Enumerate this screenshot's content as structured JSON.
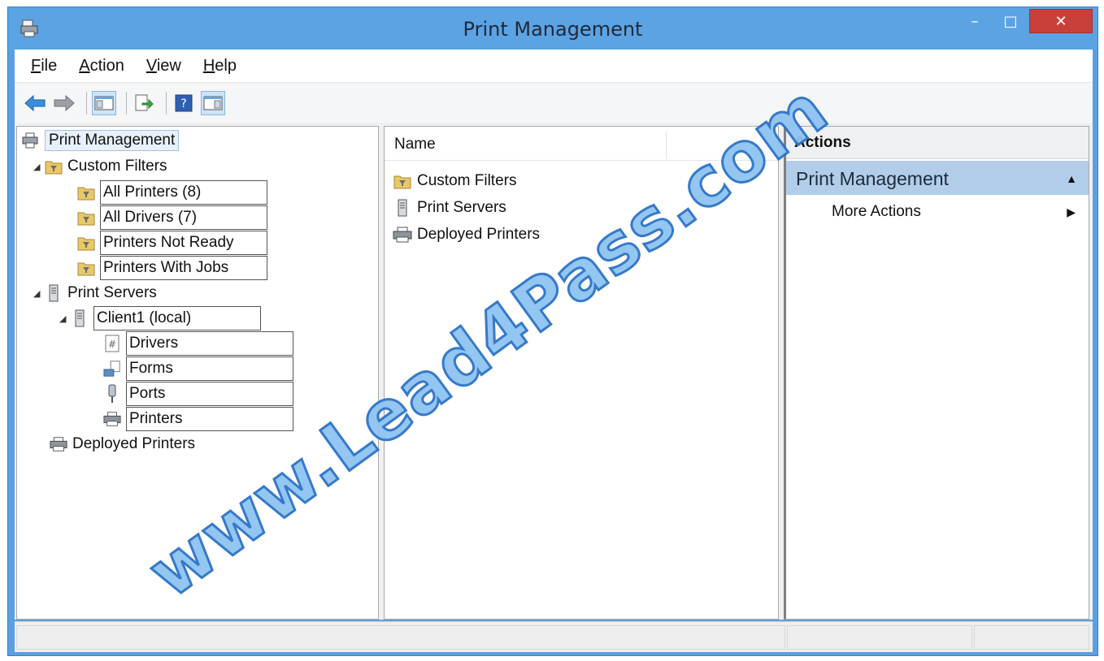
{
  "window": {
    "title": "Print Management",
    "accent": "#5ca3e4",
    "close_color": "#c9403b",
    "controls": {
      "minimize": "–",
      "maximize": "□",
      "close": "✕"
    }
  },
  "menubar": [
    {
      "first": "F",
      "rest": "ile"
    },
    {
      "first": "A",
      "rest": "ction"
    },
    {
      "first": "V",
      "rest": "iew"
    },
    {
      "first": "H",
      "rest": "elp"
    }
  ],
  "toolbar": {
    "icons": [
      "back-arrow-icon",
      "forward-arrow-icon",
      "show-hide-console-tree-icon",
      "export-list-icon",
      "help-icon",
      "show-hide-action-pane-icon"
    ]
  },
  "tree": {
    "root": "Print Management",
    "custom_filters": "Custom Filters",
    "all_printers": "All Printers (8)",
    "all_drivers": "All Drivers (7)",
    "printers_not_ready": "Printers Not Ready",
    "printers_with_jobs": "Printers With Jobs",
    "print_servers": "Print Servers",
    "client1": "Client1 (local)",
    "drivers": "Drivers",
    "forms": "Forms",
    "ports": "Ports",
    "printers": "Printers",
    "deployed_printers": "Deployed Printers"
  },
  "list": {
    "header_name": "Name",
    "rows": [
      "Custom Filters",
      "Print Servers",
      "Deployed Printers"
    ]
  },
  "actions": {
    "header": "Actions",
    "group": "Print Management",
    "more_actions": "More Actions"
  },
  "watermark": "www.Lead4Pass.com"
}
